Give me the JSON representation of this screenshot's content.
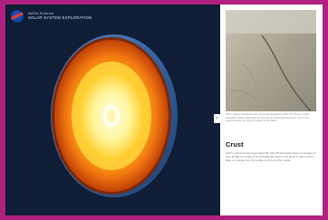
{
  "header": {
    "org_name": "NASA Science",
    "site_title": "SOLAR SYSTEM EXPLORATION"
  },
  "viewer": {
    "collapse_glyph": "‹"
  },
  "panel": {
    "image_caption": "When oceanic lithosphere and continental lithosphere collide, the denser oceanic lithosphere slides underneath the less dense continental lithosphere. Crust is the outermost layer, forming the surface of the planet.",
    "section_title": "Crust",
    "body": "Earth's outermost layer goes about 30 miles (50 kilometers) deep on average on land, as little as 3 miles (5 km) beneath the oceans, and about 6 miles (10 km) deep on average from the surface to the top of the mantle."
  },
  "colors": {
    "background_frame": "#b0207f",
    "viewer_background": "#101d36",
    "panel_background": "#ffffff",
    "core_hot": "#fff59a",
    "mantle_orange": "#f0760f",
    "crust_blue": "#2b5e9e"
  }
}
